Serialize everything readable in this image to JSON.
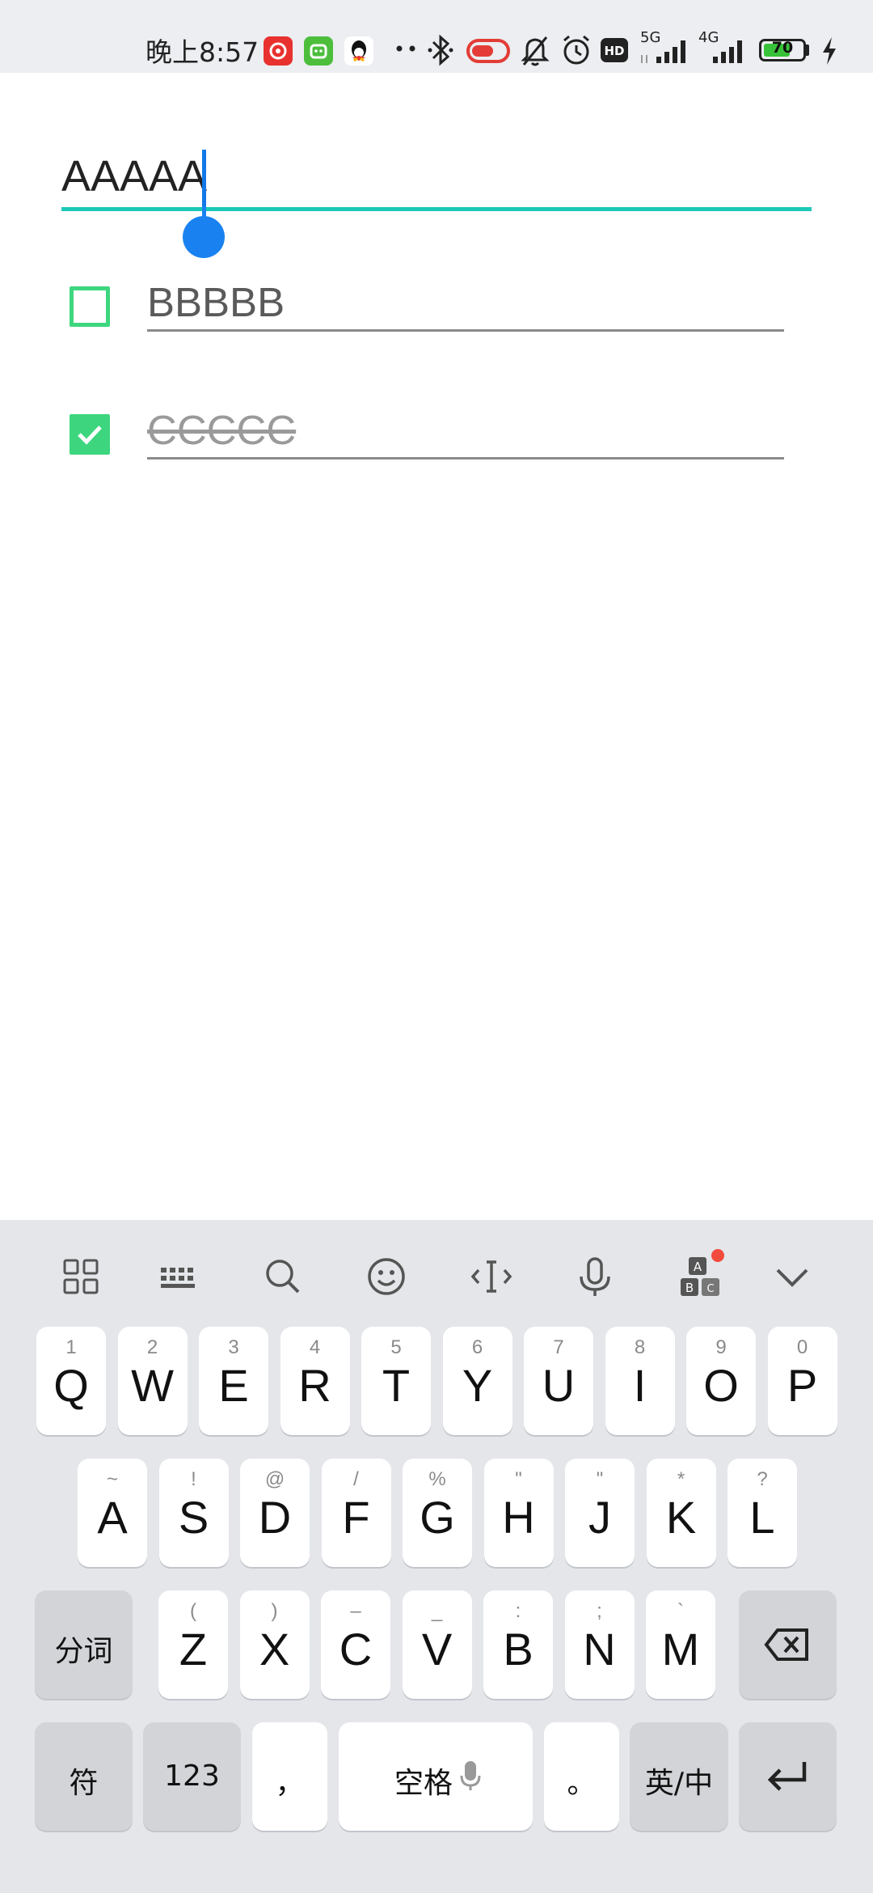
{
  "status_bar": {
    "time": "晚上8:57",
    "network_5g": "5G",
    "network_4g": "4G",
    "battery_percent": "70",
    "battery_level": 0.7,
    "icons": [
      "netease-music-icon",
      "green-app-icon",
      "qq-icon",
      "more-dots-icon",
      "bluetooth-icon",
      "red-toggle-icon",
      "silent-bell-icon",
      "alarm-icon",
      "hd-icon",
      "signal-5g-icon",
      "signal-4g-icon",
      "battery-icon",
      "charging-icon"
    ]
  },
  "editor": {
    "active_value": "AAAAA",
    "accent_color": "#1cc8b7",
    "cursor_color": "#1a82f0"
  },
  "todos": [
    {
      "text": "BBBBB",
      "checked": false
    },
    {
      "text": "CCCCC",
      "checked": true
    }
  ],
  "keyboard": {
    "toolbar_icons": [
      "grid-menu-icon",
      "keyboard-layout-icon",
      "search-icon",
      "emoji-icon",
      "cursor-move-icon",
      "microphone-icon",
      "abc-blocks-icon",
      "collapse-chevron-icon"
    ],
    "row1": [
      {
        "hint": "1",
        "key": "Q"
      },
      {
        "hint": "2",
        "key": "W"
      },
      {
        "hint": "3",
        "key": "E"
      },
      {
        "hint": "4",
        "key": "R"
      },
      {
        "hint": "5",
        "key": "T"
      },
      {
        "hint": "6",
        "key": "Y"
      },
      {
        "hint": "7",
        "key": "U"
      },
      {
        "hint": "8",
        "key": "I"
      },
      {
        "hint": "9",
        "key": "O"
      },
      {
        "hint": "0",
        "key": "P"
      }
    ],
    "row2": [
      {
        "hint": "~",
        "key": "A"
      },
      {
        "hint": "!",
        "key": "S"
      },
      {
        "hint": "@",
        "key": "D"
      },
      {
        "hint": "/",
        "key": "F"
      },
      {
        "hint": "%",
        "key": "G"
      },
      {
        "hint": "\"",
        "key": "H"
      },
      {
        "hint": "\"",
        "key": "J"
      },
      {
        "hint": "*",
        "key": "K"
      },
      {
        "hint": "?",
        "key": "L"
      }
    ],
    "row3": [
      {
        "hint": "(",
        "key": "Z"
      },
      {
        "hint": ")",
        "key": "X"
      },
      {
        "hint": "–",
        "key": "C"
      },
      {
        "hint": "_",
        "key": "V"
      },
      {
        "hint": ":",
        "key": "B"
      },
      {
        "hint": ";",
        "key": "N"
      },
      {
        "hint": "`",
        "key": "M"
      }
    ],
    "segment_label": "分词",
    "symbol_label": "符",
    "numbers_label": "123",
    "comma_label": "，",
    "space_label": "空格",
    "period_label": "。",
    "lang_en": "英",
    "lang_sep": "/",
    "lang_zh": "中"
  }
}
